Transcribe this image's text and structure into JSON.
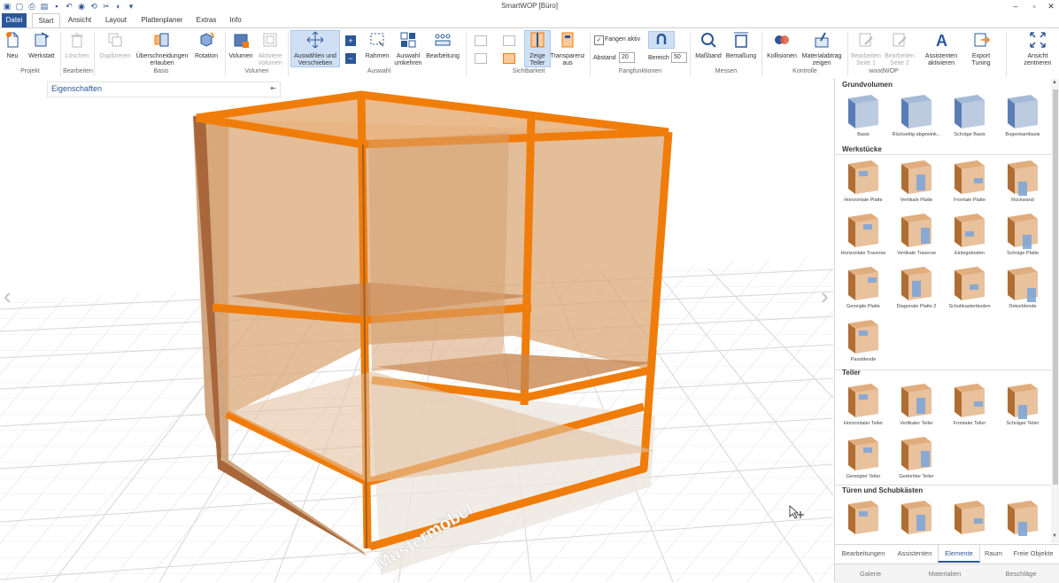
{
  "app": {
    "title": "SmartWOP [Büro]"
  },
  "window_controls": {
    "minimize": "–",
    "maximize": "▫",
    "close": "✕"
  },
  "quick_access": [
    "save-icon",
    "new-icon",
    "print-icon",
    "camera-icon",
    "undo-icon",
    "redo-icon",
    "cut-icon",
    "sync-icon",
    "menu-icon"
  ],
  "tabs": [
    {
      "label": "Datei",
      "kind": "file"
    },
    {
      "label": "Start",
      "kind": "active"
    },
    {
      "label": "Ansicht",
      "kind": "normal"
    },
    {
      "label": "Layout",
      "kind": "normal"
    },
    {
      "label": "Plattenplaner",
      "kind": "normal"
    },
    {
      "label": "Extras",
      "kind": "normal"
    },
    {
      "label": "Info",
      "kind": "normal"
    }
  ],
  "ribbon": {
    "buttons": [
      {
        "label": "Neu",
        "state": "normal",
        "icon": "new-doc-icon"
      },
      {
        "label": "Werkstatt",
        "state": "normal",
        "icon": "workshop-icon"
      },
      {
        "label": "Löschen",
        "state": "disabled",
        "icon": "trash-icon"
      },
      {
        "label": "Duplizieren",
        "state": "disabled",
        "icon": "duplicate-icon"
      },
      {
        "label": "Überschneidungen erlauben",
        "state": "normal",
        "icon": "overlap-icon"
      },
      {
        "label": "Rotation",
        "state": "normal",
        "icon": "rotation-icon"
      },
      {
        "label": "Volumen",
        "state": "normal",
        "icon": "volume-icon"
      },
      {
        "label": "Aktiviere Volumen",
        "state": "disabled",
        "icon": "activate-volume-icon"
      },
      {
        "label": "Auswählen und Verschieben",
        "state": "selected",
        "icon": "move-icon"
      },
      {
        "label": "Rahmen",
        "state": "normal",
        "icon": "frame-icon"
      },
      {
        "label": "Auswahl umkehren",
        "state": "normal",
        "icon": "invert-selection-icon"
      },
      {
        "label": "Bearbeitung",
        "state": "normal",
        "icon": "edit-icon"
      },
      {
        "label": "Zeige Teiler",
        "state": "selected",
        "icon": "show-divider-icon"
      },
      {
        "label": "Transparenz aus",
        "state": "normal",
        "icon": "transparency-icon"
      },
      {
        "label": "Maßband",
        "state": "normal",
        "icon": "measure-tape-icon"
      },
      {
        "label": "Bemaßung",
        "state": "normal",
        "icon": "dimension-icon"
      },
      {
        "label": "Kollisionen",
        "state": "normal",
        "icon": "collision-icon"
      },
      {
        "label": "Materialabtrag zeigen",
        "state": "normal",
        "icon": "material-removal-icon"
      },
      {
        "label": "Bearbeiten Seite 1",
        "state": "disabled",
        "icon": "edit-side1-icon"
      },
      {
        "label": "Bearbeiten Seite 2",
        "state": "disabled",
        "icon": "edit-side2-icon"
      },
      {
        "label": "Assistenten aktivieren",
        "state": "normal",
        "icon": "assistant-icon"
      },
      {
        "label": "Export Tuning",
        "state": "normal",
        "icon": "export-icon"
      },
      {
        "label": "Ansicht zentrieren",
        "state": "normal",
        "icon": "center-view-icon"
      }
    ],
    "groups": [
      "Projekt",
      "Bearbeiten",
      "Basis",
      "Volumen",
      "Auswahl",
      "Sichtbarkeit",
      "Fangfunktionen",
      "Messen",
      "Kontrolle",
      "woodWOP"
    ],
    "snap": {
      "checkbox_label": "Fangen aktiv",
      "checked": true,
      "distance_label": "Abstand",
      "distance_value": "20",
      "range_label": "Bereich",
      "range_value": "50"
    }
  },
  "viewport": {
    "properties_title": "Eigenschaften",
    "watermark": "Mustermöbel",
    "accent": "#f07d0a"
  },
  "panel": {
    "sections": [
      {
        "title": "Grundvolumen",
        "items": [
          "Basis",
          "Rückseitig abgewink...",
          "Schräge Basis",
          "Bogenkantbasis"
        ]
      },
      {
        "title": "Werkstücke",
        "items": [
          "Horizontale Platte",
          "Vertikale Platte",
          "Frontale Platte",
          "Rückwand",
          "Horizontale Traverse",
          "Vertikale Traverse",
          "Einlegeboden",
          "Schräge Platte",
          "Geneigte Platte",
          "Diagonale Platte 2",
          "Schubkastenboden",
          "Dekorblende",
          "Passblende"
        ]
      },
      {
        "title": "Teiler",
        "items": [
          "Horizontaler Teiler",
          "Vertikaler Teiler",
          "Frontaler Teiler",
          "Schräger Teiler",
          "Geneigter Teiler",
          "Gedrehter Teiler"
        ]
      },
      {
        "title": "Türen und Schubkästen",
        "items": [
          "",
          "",
          "",
          ""
        ]
      }
    ],
    "tabs": [
      {
        "label": "Bearbeitungen",
        "active": false
      },
      {
        "label": "Assistenten",
        "active": false
      },
      {
        "label": "Elemente",
        "active": true
      },
      {
        "label": "Raum",
        "active": false
      },
      {
        "label": "Freie Objekte",
        "active": false
      }
    ],
    "bottom_tabs": [
      "Galerie",
      "Materialien",
      "Beschläge"
    ]
  }
}
